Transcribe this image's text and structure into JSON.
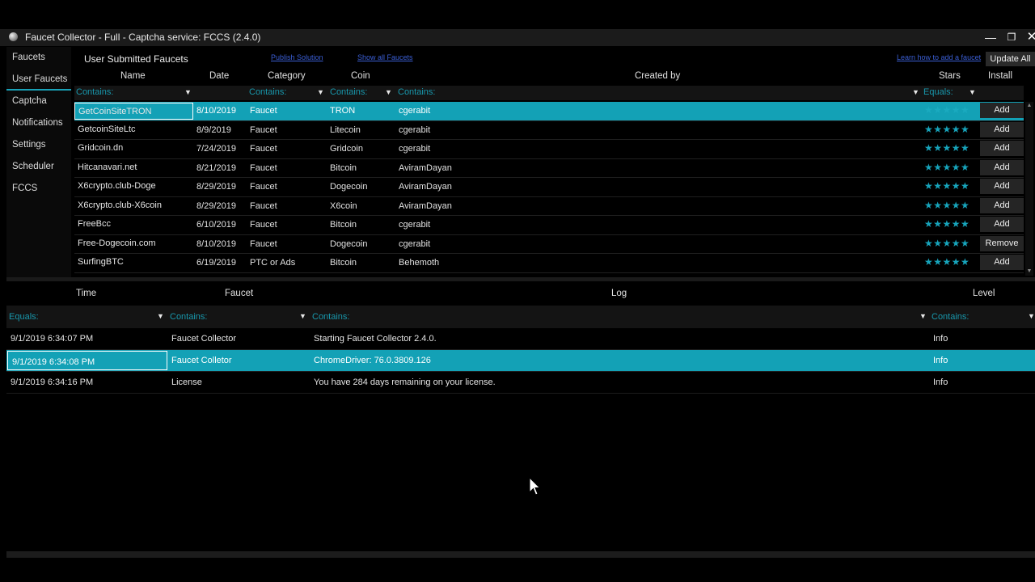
{
  "window": {
    "title": "Faucet Collector - Full - Captcha service: FCCS (2.4.0)",
    "controls": {
      "minimize": "—",
      "maximize": "❐",
      "close": "✕"
    }
  },
  "sidebar": {
    "items": [
      {
        "label": "Faucets"
      },
      {
        "label": "User Faucets",
        "active": true
      },
      {
        "label": "Captcha"
      },
      {
        "label": "Notifications"
      },
      {
        "label": "Settings"
      },
      {
        "label": "Scheduler"
      },
      {
        "label": "FCCS"
      }
    ]
  },
  "faucets_panel": {
    "title": "User Submitted Faucets",
    "links": [
      "Publish Solution",
      "Show all Faucets",
      "Learn how to add a faucet"
    ],
    "update_all_label": "Update All",
    "columns": {
      "name": "Name",
      "date": "Date",
      "category": "Category",
      "coin": "Coin",
      "created_by": "Created by",
      "stars": "Stars",
      "install": "Install"
    },
    "filters": {
      "name": "Contains:",
      "category": "Contains:",
      "coin": "Contains:",
      "created_by": "Contains:",
      "stars": "Equals:"
    },
    "funnel_glyph": "▼",
    "star_glyphs": "★★★★★",
    "rows": [
      {
        "name": "GetCoinSiteTRON",
        "date": "8/10/2019",
        "category": "Faucet",
        "coin": "TRON",
        "created_by": "cgerabit",
        "action": "Add",
        "selected": true
      },
      {
        "name": "GetcoinSiteLtc",
        "date": "8/9/2019",
        "category": "Faucet",
        "coin": "Litecoin",
        "created_by": "cgerabit",
        "action": "Add"
      },
      {
        "name": "Gridcoin.dn",
        "date": "7/24/2019",
        "category": "Faucet",
        "coin": "Gridcoin",
        "created_by": "cgerabit",
        "action": "Add"
      },
      {
        "name": "Hitcanavari.net",
        "date": "8/21/2019",
        "category": "Faucet",
        "coin": "Bitcoin",
        "created_by": "AviramDayan",
        "action": "Add"
      },
      {
        "name": "X6crypto.club-Doge",
        "date": "8/29/2019",
        "category": "Faucet",
        "coin": "Dogecoin",
        "created_by": "AviramDayan",
        "action": "Add"
      },
      {
        "name": "X6crypto.club-X6coin",
        "date": "8/29/2019",
        "category": "Faucet",
        "coin": "X6coin",
        "created_by": "AviramDayan",
        "action": "Add"
      },
      {
        "name": "FreeBcc",
        "date": "6/10/2019",
        "category": "Faucet",
        "coin": "Bitcoin",
        "created_by": "cgerabit",
        "action": "Add"
      },
      {
        "name": "Free-Dogecoin.com",
        "date": "8/10/2019",
        "category": "Faucet",
        "coin": "Dogecoin",
        "created_by": "cgerabit",
        "action": "Remove"
      },
      {
        "name": "SurfingBTC",
        "date": "6/19/2019",
        "category": "PTC or Ads",
        "coin": "Bitcoin",
        "created_by": "Behemoth",
        "action": "Add"
      }
    ]
  },
  "log_panel": {
    "columns": {
      "time": "Time",
      "faucet": "Faucet",
      "log": "Log",
      "level": "Level"
    },
    "filters": {
      "time": "Equals:",
      "faucet": "Contains:",
      "log": "Contains:",
      "level": "Contains:"
    },
    "rows": [
      {
        "time": "9/1/2019 6:34:07 PM",
        "faucet": "Faucet Collector",
        "log": "Starting Faucet Collector 2.4.0.",
        "level": "Info"
      },
      {
        "time": "9/1/2019 6:34:08 PM",
        "faucet": "Faucet Colletor",
        "log": "ChromeDriver: 76.0.3809.126",
        "level": "Info",
        "selected": true
      },
      {
        "time": "9/1/2019 6:34:16 PM",
        "faucet": "License",
        "log": "You have 284 days remaining on your license.",
        "level": "Info"
      }
    ]
  },
  "colors": {
    "accent": "#13a1b6",
    "filter_text": "#1897ac",
    "link": "#3b5fd6",
    "background": "#000000"
  }
}
